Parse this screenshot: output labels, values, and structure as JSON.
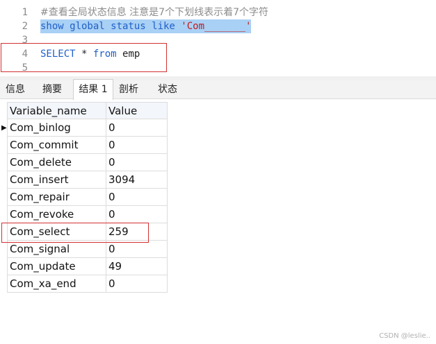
{
  "editor": {
    "lines": [
      {
        "num": "1",
        "text": "#查看全局状态信息 注意是7个下划线表示着7个字符"
      },
      {
        "num": "2",
        "kw": "show global status like ",
        "str": "'Com_______'"
      },
      {
        "num": "3"
      },
      {
        "num": "4",
        "kw1": "SELECT",
        "plain1": " * ",
        "kw2": "from",
        "plain2": " emp"
      },
      {
        "num": "5"
      }
    ]
  },
  "tabs": [
    "信息",
    "摘要",
    "结果 1",
    "剖析",
    "状态"
  ],
  "table": {
    "headers": [
      "Variable_name",
      "Value"
    ],
    "rows": [
      [
        "Com_binlog",
        "0"
      ],
      [
        "Com_commit",
        "0"
      ],
      [
        "Com_delete",
        "0"
      ],
      [
        "Com_insert",
        "3094"
      ],
      [
        "Com_repair",
        "0"
      ],
      [
        "Com_revoke",
        "0"
      ],
      [
        "Com_select",
        "259"
      ],
      [
        "Com_signal",
        "0"
      ],
      [
        "Com_update",
        "49"
      ],
      [
        "Com_xa_end",
        "0"
      ]
    ]
  },
  "watermark": "CSDN @leslie..",
  "colors": {
    "highlight_box": "#d32f2f",
    "selection": "#a9d0f5",
    "keyword": "#2060c8",
    "string": "#c21a1a"
  }
}
